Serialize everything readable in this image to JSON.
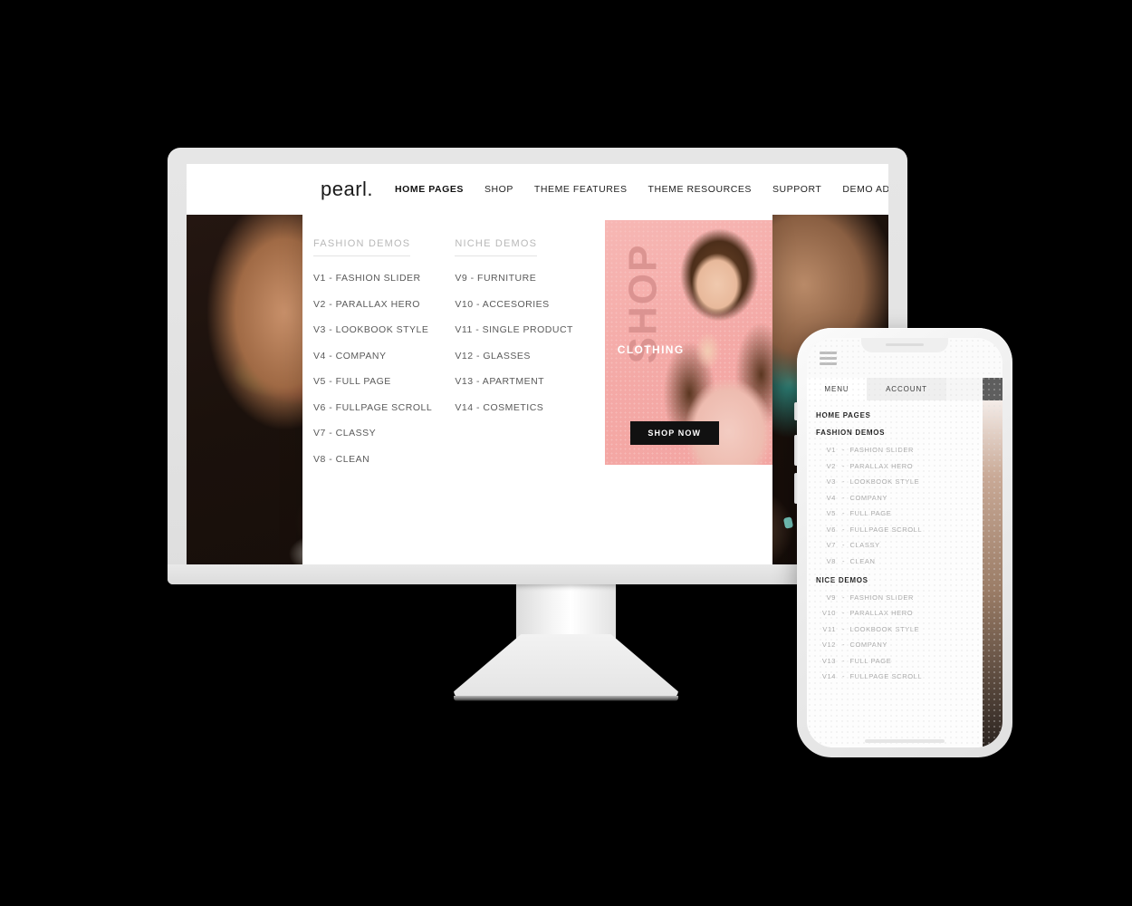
{
  "site": {
    "brand": "pearl.",
    "nav": [
      {
        "label": "HOME PAGES",
        "active": true
      },
      {
        "label": "SHOP",
        "active": false
      },
      {
        "label": "THEME FEATURES",
        "active": false
      },
      {
        "label": "THEME RESOURCES",
        "active": false
      },
      {
        "label": "SUPPORT",
        "active": false
      },
      {
        "label": "DEMO ADMIN",
        "active": false
      }
    ],
    "icons": [
      {
        "name": "search-icon"
      },
      {
        "name": "cart-icon"
      }
    ]
  },
  "mega_menu": {
    "columns": [
      {
        "title": "FASHION DEMOS",
        "links": [
          "V1 - FASHION SLIDER",
          "V2 - PARALLAX HERO",
          "V3 - LOOKBOOK STYLE",
          "V4 - COMPANY",
          "V5 - FULL PAGE",
          "V6 - FULLPAGE SCROLL",
          "V7 - CLASSY",
          "V8 - CLEAN"
        ]
      },
      {
        "title": "NICHE DEMOS",
        "links": [
          "V9 - FURNITURE",
          "V10 - ACCESORIES",
          "V11 - SINGLE PRODUCT",
          "V12 - GLASSES",
          "V13 - APARTMENT",
          "V14 - COSMETICS"
        ]
      }
    ],
    "promo": {
      "headline": "SHOP",
      "subhead": "CLOTHING",
      "cta": "SHOP NOW",
      "bg_color": "#f4a9a6",
      "cta_bg": "#111111"
    }
  },
  "phone": {
    "tabs": [
      {
        "label": "MENU",
        "active": true
      },
      {
        "label": "ACCOUNT",
        "active": false
      }
    ],
    "menu": {
      "root_label": "HOME PAGES",
      "groups": [
        {
          "title": "FASHION DEMOS",
          "items": [
            {
              "num": "V1",
              "label": "FASHION SLIDER"
            },
            {
              "num": "V2",
              "label": "PARALLAX HERO"
            },
            {
              "num": "V3",
              "label": "LOOKBOOK STYLE"
            },
            {
              "num": "V4",
              "label": "COMPANY"
            },
            {
              "num": "V5",
              "label": "FULL PAGE"
            },
            {
              "num": "V6",
              "label": "FULLPAGE SCROLL"
            },
            {
              "num": "V7",
              "label": "CLASSY"
            },
            {
              "num": "V8",
              "label": "CLEAN"
            }
          ]
        },
        {
          "title": "NICE DEMOS",
          "items": [
            {
              "num": "V9",
              "label": "FASHION SLIDER"
            },
            {
              "num": "V10",
              "label": "PARALLAX HERO"
            },
            {
              "num": "V11",
              "label": "LOOKBOOK STYLE"
            },
            {
              "num": "V12",
              "label": "COMPANY"
            },
            {
              "num": "V13",
              "label": "FULL PAGE"
            },
            {
              "num": "V14",
              "label": "FULLPAGE SCROLL"
            }
          ]
        }
      ]
    }
  }
}
